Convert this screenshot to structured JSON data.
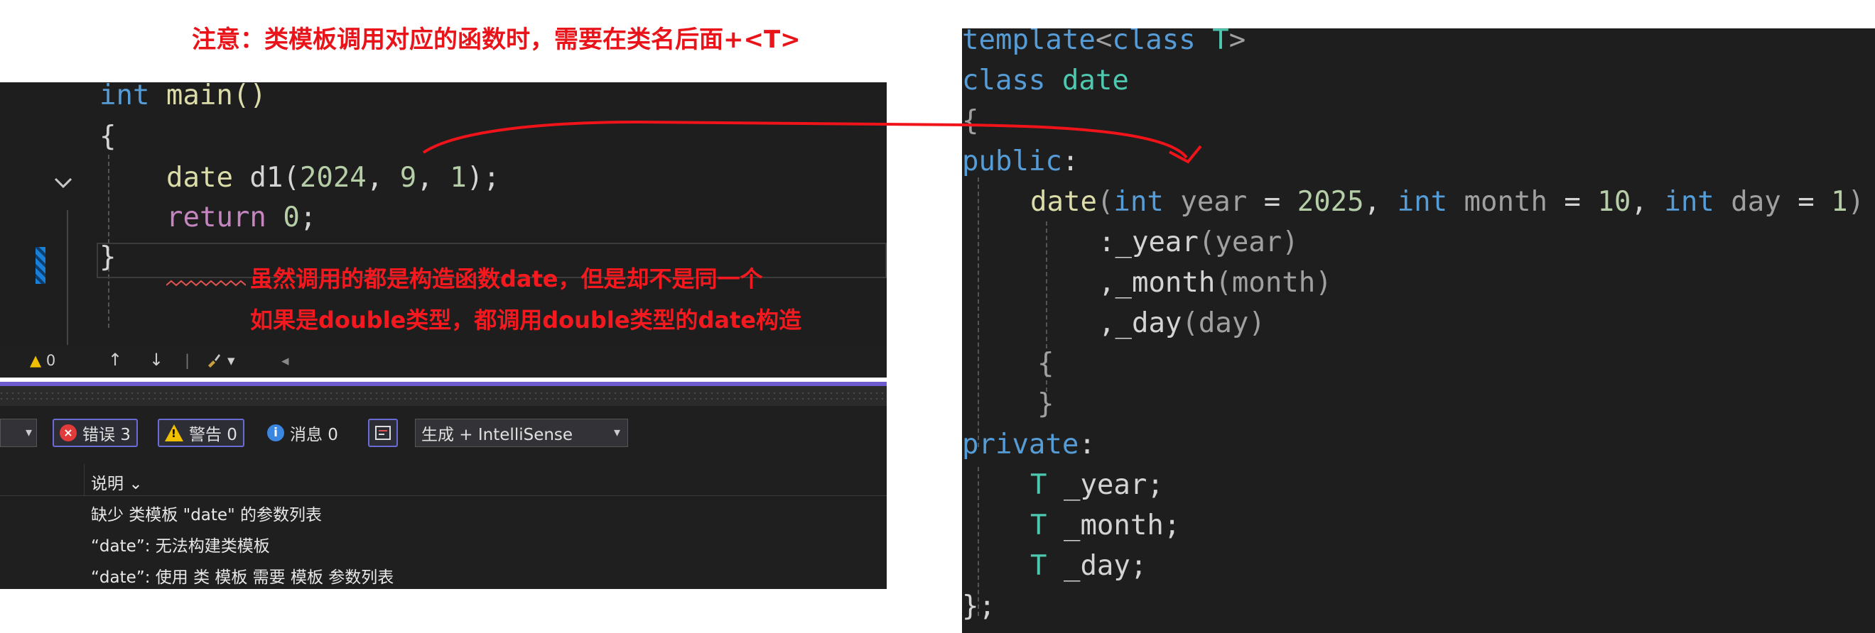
{
  "annotations": {
    "top_note": "注意：类模板调用对应的函数时，需要在类名后面+<T>",
    "overlay_line1": "虽然调用的都是构造函数date，但是却不是同一个",
    "overlay_line2": "如果是double类型，都调用double类型的date构造"
  },
  "editor_left": {
    "l1_kw": "int",
    "l1_rest": " main()",
    "l2": "{",
    "l3_fn": "date",
    "l3_d1": " d1",
    "l3_open": "(",
    "l3_n1": "2024",
    "l3_c1": ", ",
    "l3_n2": "9",
    "l3_c2": ", ",
    "l3_n3": "1",
    "l3_close": ");",
    "l4_kw": "return",
    "l4_sp": " ",
    "l4_num": "0",
    "l4_semi": ";",
    "l5": "}"
  },
  "status_strip": {
    "warning_count": "0",
    "up_arrow": "↑",
    "down_arrow": "↓",
    "separator": "|",
    "brush_caret": "▾",
    "scroll_left": "◂"
  },
  "error_toolbar": {
    "errors_label": "错误 3",
    "warnings_label": "警告 0",
    "messages_label": "消息 0",
    "build_filter": "生成 + IntelliSense",
    "combo_caret": "▾",
    "left_combo_caret": "▾",
    "error_glyph": "×",
    "warning_glyph": "!",
    "info_glyph": "i"
  },
  "error_list": {
    "column_header": "说明",
    "header_caret": "⌄",
    "rows": [
      "缺少 类模板 \"date\" 的参数列表",
      "“date”: 无法构建类模板",
      "“date”: 使用 类 模板 需要 模板 参数列表"
    ]
  },
  "editor_right": {
    "r1_kw1": "template",
    "r1_a": "<",
    "r1_kw2": "class",
    "r1_sp": " ",
    "r1_t": "T",
    "r1_b": ">",
    "r2_kw": "class",
    "r2_sp": " ",
    "r2_name": "date",
    "r3": "{",
    "r4_kw": "public",
    "r4_colon": ":",
    "r5_fn": "date",
    "r5_open": "(",
    "r5_int1": "int",
    "r5_p1": " year",
    "r5_eq1": " = ",
    "r5_n1": "2025",
    "r5_c1": ", ",
    "r5_int2": "int",
    "r5_p2": " month",
    "r5_eq2": " = ",
    "r5_n2": "10",
    "r5_c2": ", ",
    "r5_int3": "int",
    "r5_p3": " day",
    "r5_eq3": " = ",
    "r5_n3": "1",
    "r5_close": ")",
    "r6_a": ":_year",
    "r6_b": "(year)",
    "r7_a": ",_month",
    "r7_b": "(month)",
    "r8_a": ",_day",
    "r8_b": "(day)",
    "r9": "{",
    "r10": "}",
    "r11_kw": "private",
    "r11_colon": ":",
    "r12_t": "T",
    "r12_rest": " _year;",
    "r13_t": "T",
    "r13_rest": " _month;",
    "r14_t": "T",
    "r14_rest": " _day;",
    "r15": "};"
  }
}
